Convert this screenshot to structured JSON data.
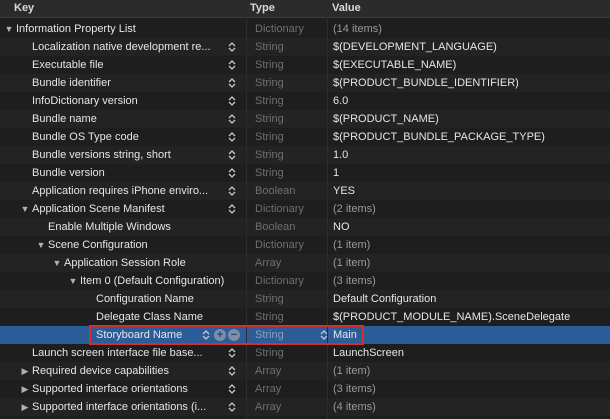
{
  "header": {
    "key": "Key",
    "type": "Type",
    "value": "Value"
  },
  "rows": [
    {
      "key": "Information Property List",
      "type": "Dictionary",
      "value": "(14 items)",
      "disclosure": "expanded"
    },
    {
      "key": "Localization native development re...",
      "type": "String",
      "value": "$(DEVELOPMENT_LANGUAGE)",
      "disclosure": "none",
      "stepper": true
    },
    {
      "key": "Executable file",
      "type": "String",
      "value": "$(EXECUTABLE_NAME)",
      "disclosure": "none",
      "stepper": true
    },
    {
      "key": "Bundle identifier",
      "type": "String",
      "value": "$(PRODUCT_BUNDLE_IDENTIFIER)",
      "disclosure": "none",
      "stepper": true
    },
    {
      "key": "InfoDictionary version",
      "type": "String",
      "value": "6.0",
      "disclosure": "none",
      "stepper": true
    },
    {
      "key": "Bundle name",
      "type": "String",
      "value": "$(PRODUCT_NAME)",
      "disclosure": "none",
      "stepper": true
    },
    {
      "key": "Bundle OS Type code",
      "type": "String",
      "value": "$(PRODUCT_BUNDLE_PACKAGE_TYPE)",
      "disclosure": "none",
      "stepper": true
    },
    {
      "key": "Bundle versions string, short",
      "type": "String",
      "value": "1.0",
      "disclosure": "none",
      "stepper": true
    },
    {
      "key": "Bundle version",
      "type": "String",
      "value": "1",
      "disclosure": "none",
      "stepper": true
    },
    {
      "key": "Application requires iPhone enviro...",
      "type": "Boolean",
      "value": "YES",
      "disclosure": "none",
      "stepper": true
    },
    {
      "key": "Application Scene Manifest",
      "type": "Dictionary",
      "value": "(2 items)",
      "disclosure": "expanded",
      "stepper": true
    },
    {
      "key": "Enable Multiple Windows",
      "type": "Boolean",
      "value": "NO",
      "disclosure": "none"
    },
    {
      "key": "Scene Configuration",
      "type": "Dictionary",
      "value": "(1 item)",
      "disclosure": "expanded"
    },
    {
      "key": "Application Session Role",
      "type": "Array",
      "value": "(1 item)",
      "disclosure": "expanded"
    },
    {
      "key": "Item 0 (Default Configuration)",
      "type": "Dictionary",
      "value": "(3 items)",
      "disclosure": "expanded"
    },
    {
      "key": "Configuration Name",
      "type": "String",
      "value": "Default Configuration",
      "disclosure": "none"
    },
    {
      "key": "Delegate Class Name",
      "type": "String",
      "value": "$(PRODUCT_MODULE_NAME).SceneDelegate",
      "disclosure": "none"
    },
    {
      "key": "Storyboard Name",
      "type": "String",
      "value": "Main",
      "disclosure": "none",
      "selected": true
    },
    {
      "key": "Launch screen interface file base...",
      "type": "String",
      "value": "LaunchScreen",
      "disclosure": "none",
      "stepper": true
    },
    {
      "key": "Required device capabilities",
      "type": "Array",
      "value": "(1 item)",
      "disclosure": "collapsed",
      "stepper": true
    },
    {
      "key": "Supported interface orientations",
      "type": "Array",
      "value": "(3 items)",
      "disclosure": "collapsed",
      "stepper": true
    },
    {
      "key": "Supported interface orientations (i...",
      "type": "Array",
      "value": "(4 items)",
      "disclosure": "collapsed",
      "stepper": true
    }
  ],
  "icons": {
    "stepper": "up-down-stepper-icon",
    "add": "plus-circle-icon",
    "remove": "minus-circle-icon",
    "expanded": "triangle-down-icon",
    "collapsed": "triangle-right-icon"
  },
  "colors": {
    "selection": "#2c5d98",
    "highlight_border": "#d0312d",
    "background": "#1e1e1e"
  }
}
